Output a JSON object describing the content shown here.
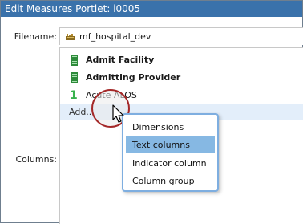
{
  "window": {
    "title": "Edit Measures Portlet: i0005"
  },
  "form": {
    "filename_label": "Filename:",
    "filename_value": "mf_hospital_dev",
    "columns_label": "Columns:"
  },
  "columns": {
    "items": [
      {
        "label": "Admit Facility",
        "icon": "dimension-icon",
        "bold": true
      },
      {
        "label": "Admitting Provider",
        "icon": "dimension-icon",
        "bold": true
      },
      {
        "label": "Acute ALOS",
        "icon": "measure-icon",
        "bold": false,
        "badge": "1"
      }
    ],
    "add_label": "Add..."
  },
  "dropdown": {
    "items": [
      {
        "label": "Dimensions",
        "selected": false
      },
      {
        "label": "Text columns",
        "selected": true
      },
      {
        "label": "Indicator column",
        "selected": false
      },
      {
        "label": "Column group",
        "selected": false
      }
    ]
  },
  "colors": {
    "titlebar": "#3a72ab",
    "selected_menu": "#86b8e3",
    "add_row": "#e3eefa",
    "dimension_icon": "#2d8a3a",
    "measure_icon": "#37b24d",
    "highlight_ring": "#a42828"
  }
}
